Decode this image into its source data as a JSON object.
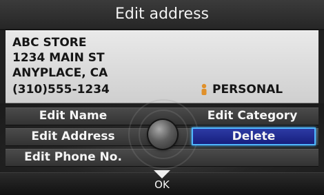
{
  "title": "Edit address",
  "address": {
    "name": "ABC STORE",
    "street": "1234 MAIN ST",
    "city_state": "ANYPLACE, CA",
    "phone": "(310)555-1234",
    "category": "PERSONAL",
    "category_icon": "personal-category-icon"
  },
  "menu": {
    "left": [
      "Edit Name",
      "Edit Address",
      "Edit Phone No."
    ],
    "right": [
      "Edit Category",
      "Delete"
    ],
    "selected": "Delete"
  },
  "ok_label": "OK",
  "colors": {
    "selection_fill": "#1f2a94",
    "selection_border": "#4fb6ff",
    "category_icon": "#e0902a"
  }
}
